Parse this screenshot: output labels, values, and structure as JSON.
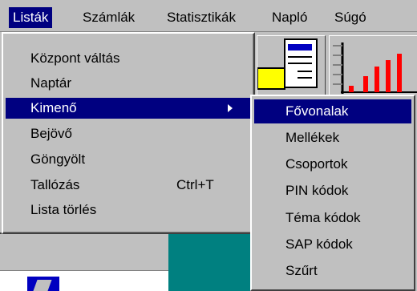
{
  "menubar": {
    "items": [
      {
        "label": "Listák",
        "active": true
      },
      {
        "label": "Számlák",
        "active": false
      },
      {
        "label": "Statisztikák",
        "active": false
      },
      {
        "label": "Napló",
        "active": false
      },
      {
        "label": "Súgó",
        "active": false
      }
    ]
  },
  "menu": {
    "items": [
      {
        "label": "Központ váltás",
        "shortcut": ""
      },
      {
        "label": "Naptár",
        "shortcut": ""
      },
      {
        "label": "Kimenő",
        "shortcut": "",
        "submenu": true
      },
      {
        "label": "Bejövő",
        "shortcut": ""
      },
      {
        "label": "Göngyölt",
        "shortcut": ""
      },
      {
        "label": "Tallózás",
        "shortcut": "Ctrl+T"
      },
      {
        "label": "Lista törlés",
        "shortcut": ""
      }
    ]
  },
  "submenu": {
    "items": [
      {
        "label": "Fővonalak"
      },
      {
        "label": "Mellékek"
      },
      {
        "label": "Csoportok"
      },
      {
        "label": "PIN kódok"
      },
      {
        "label": "Téma kódok"
      },
      {
        "label": "SAP kódok"
      },
      {
        "label": "Szűrt"
      }
    ]
  },
  "colors": {
    "highlight": "#000080",
    "face": "#c0c0c0",
    "chart_bar": "#ff0000",
    "teal": "#008080"
  }
}
